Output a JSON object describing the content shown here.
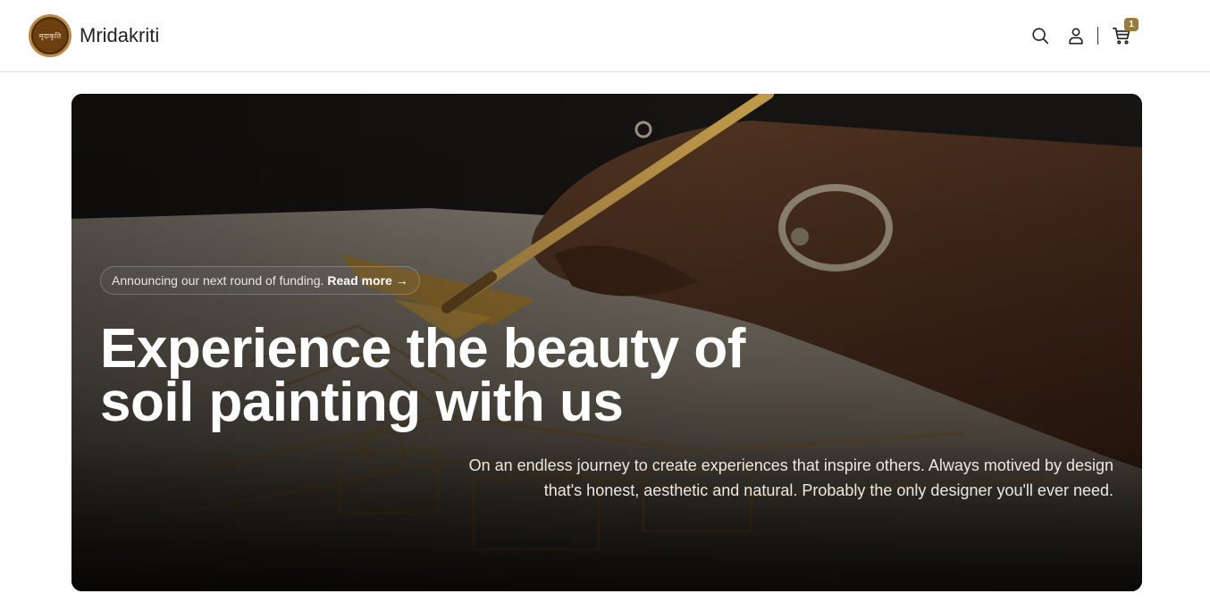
{
  "header": {
    "brand_name": "Mridakriti",
    "logo_text": "मृदाकृति",
    "icons": [
      "search-icon",
      "user-icon",
      "cart-icon"
    ],
    "cart_count": "1",
    "badge_color": "#9c7a3c"
  },
  "hero": {
    "announcement_text": "Announcing our next round of funding.",
    "announcement_link": "Read more →",
    "title_line1": "Experience the beauty of",
    "title_line2": "soil painting with us",
    "description_line1": "On an endless journey to create experiences that inspire others. Always motived by design",
    "description_line2": "that's honest, aesthetic and natural. Probably the only designer you'll ever need."
  }
}
